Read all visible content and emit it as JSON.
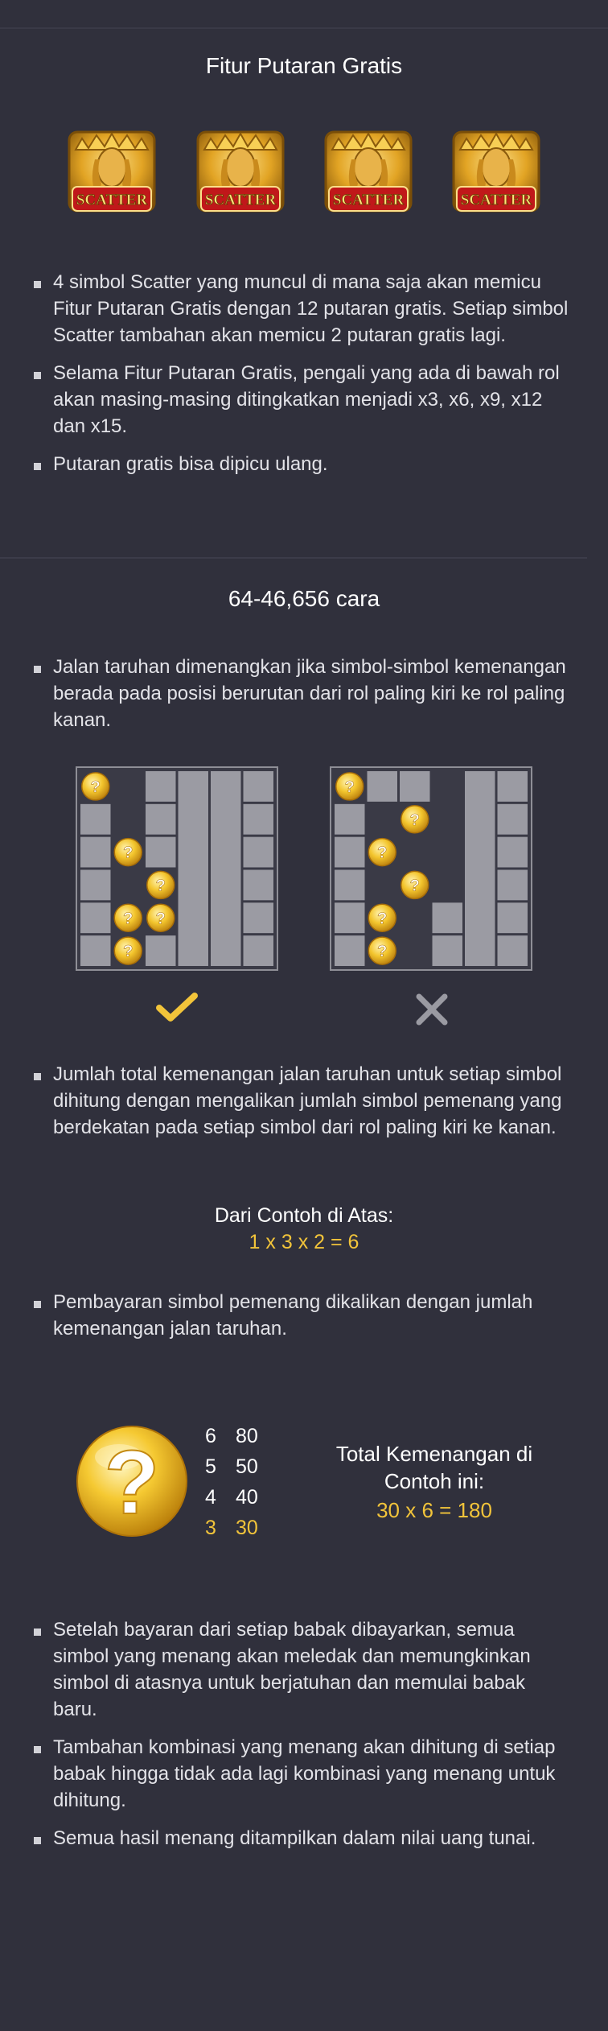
{
  "free_spins": {
    "title": "Fitur Putaran Gratis",
    "scatter_label": "SCATTER",
    "bullets": [
      "4 simbol Scatter yang muncul di mana saja akan memicu Fitur Putaran Gratis dengan 12 putaran gratis. Setiap simbol Scatter tambahan akan memicu 2 putaran gratis lagi.",
      "Selama Fitur Putaran Gratis, pengali yang ada di bawah rol akan masing-masing ditingkatkan menjadi x3, x6, x9, x12 dan x15.",
      "Putaran gratis bisa dipicu ulang."
    ]
  },
  "ways": {
    "title": "64-46,656 cara",
    "bullet_1": "Jalan taruhan dimenangkan jika simbol-simbol kemenangan berada pada posisi berurutan dari rol paling kiri ke rol paling kanan.",
    "bullet_2": "Jumlah total kemenangan jalan taruhan untuk setiap simbol dihitung dengan mengalikan jumlah simbol pemenang yang berdekatan pada setiap simbol dari rol paling kiri ke kanan.",
    "example_heading": "Dari Contoh di Atas:",
    "example_formula": "1 x 3 x 2 = 6",
    "bullet_3": "Pembayaran simbol pemenang dikalikan dengan jumlah kemenangan jalan taruhan.",
    "symbol_glyph": "?",
    "paytable": [
      {
        "count": "6",
        "value": "80"
      },
      {
        "count": "5",
        "value": "50"
      },
      {
        "count": "4",
        "value": "40"
      },
      {
        "count": "3",
        "value": "30"
      }
    ],
    "total_heading": "Total Kemenangan di Contoh ini:",
    "total_formula": "30 x 6 = 180",
    "bullets_bottom": [
      "Setelah bayaran dari setiap babak dibayarkan, semua simbol yang menang akan meledak dan memungkinkan simbol di atasnya untuk berjatuhan dan memulai babak baru.",
      "Tambahan kombinasi yang menang akan dihitung di setiap babak hingga tidak ada lagi kombinasi yang menang untuk dihitung.",
      "Semua hasil menang ditampilkan dalam nilai uang tunai."
    ]
  },
  "colors": {
    "background": "#30303c",
    "accent_gold": "#f2c43a",
    "check_mark": "#f2c43a",
    "cross_mark": "#9a9aa2",
    "grid_cell": "#9b9ba3"
  },
  "icons": [
    "scatter-symbol-icon",
    "coin-icon",
    "check-icon",
    "cross-icon",
    "question-symbol-icon"
  ]
}
